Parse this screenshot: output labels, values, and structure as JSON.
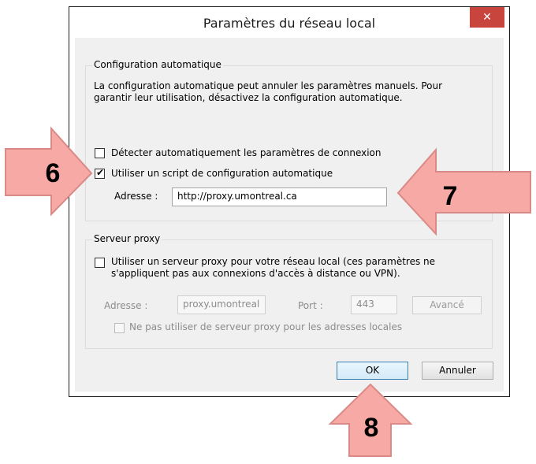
{
  "dialog": {
    "title": "Paramètres du réseau local",
    "close_glyph": "✕"
  },
  "auto_config": {
    "legend": "Configuration automatique",
    "description_line1": "La configuration automatique peut annuler les paramètres manuels. Pour",
    "description_line2": "garantir leur utilisation, désactivez la configuration automatique.",
    "detect_label": "Détecter automatiquement les paramètres de connexion",
    "detect_checked": false,
    "script_label": "Utiliser un script de configuration automatique",
    "script_checked": true,
    "address_label": "Adresse :",
    "address_value": "http://proxy.umontreal.ca"
  },
  "proxy": {
    "legend": "Serveur proxy",
    "use_proxy_line1": "Utiliser un serveur proxy pour votre réseau local (ces paramètres ne",
    "use_proxy_line2": "s'appliquent pas aux connexions d'accès à distance ou VPN).",
    "use_proxy_checked": false,
    "address_label": "Adresse :",
    "address_value": "proxy.umontreal",
    "port_label": "Port :",
    "port_value": "443",
    "advanced_label": "Avancé",
    "bypass_label": "Ne pas utiliser de serveur proxy pour les adresses locales",
    "bypass_checked": false
  },
  "buttons": {
    "ok_label": "OK",
    "cancel_label": "Annuler"
  },
  "callouts": {
    "step6": "6",
    "step7": "7",
    "step8": "8"
  },
  "colors": {
    "callout_fill": "#f6a9a5",
    "callout_stroke": "#d98a86",
    "close_button": "#c7453c"
  },
  "icons": {
    "close": "close-icon",
    "check": "checkmark-icon",
    "arrow": "arrow-icon"
  }
}
